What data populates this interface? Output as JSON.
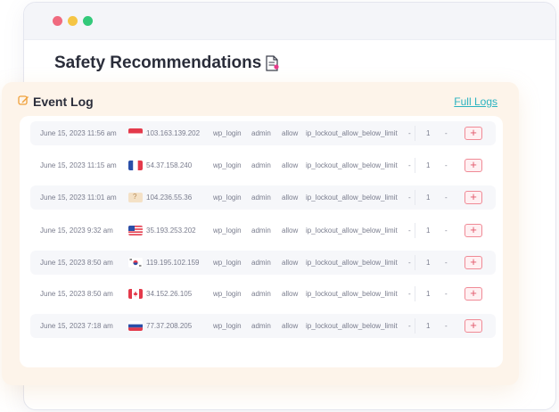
{
  "window": {
    "title": "Safety Recommendations"
  },
  "event_log": {
    "title": "Event Log",
    "full_logs_label": "Full Logs",
    "rows": [
      {
        "date": "June 15, 2023 11:56 am",
        "flag": "indonesia-flag",
        "ip": "103.163.139.202",
        "user": "wp_login",
        "role": "admin",
        "action": "allow",
        "reason": "ip_lockout_allow_below_limit",
        "d1": "-",
        "count": "1",
        "d2": "-",
        "btn": "+"
      },
      {
        "date": "June 15, 2023 11:15 am",
        "flag": "france-flag",
        "ip": "54.37.158.240",
        "user": "wp_login",
        "role": "admin",
        "action": "allow",
        "reason": "ip_lockout_allow_below_limit",
        "d1": "-",
        "count": "1",
        "d2": "-",
        "btn": "+"
      },
      {
        "date": "June 15, 2023 11:01 am",
        "flag": "unknown-flag",
        "flag_text": "?",
        "ip": "104.236.55.36",
        "user": "wp_login",
        "role": "admin",
        "action": "allow",
        "reason": "ip_lockout_allow_below_limit",
        "d1": "-",
        "count": "1",
        "d2": "-",
        "btn": "+"
      },
      {
        "date": "June 15, 2023 9:32 am",
        "flag": "usa-flag",
        "ip": "35.193.253.202",
        "user": "wp_login",
        "role": "admin",
        "action": "allow",
        "reason": "ip_lockout_allow_below_limit",
        "d1": "-",
        "count": "1",
        "d2": "-",
        "btn": "+"
      },
      {
        "date": "June 15, 2023 8:50 am",
        "flag": "south-korea-flag",
        "ip": "119.195.102.159",
        "user": "wp_login",
        "role": "admin",
        "action": "allow",
        "reason": "ip_lockout_allow_below_limit",
        "d1": "-",
        "count": "1",
        "d2": "-",
        "btn": "+"
      },
      {
        "date": "June 15, 2023 8:50 am",
        "flag": "canada-flag",
        "ip": "34.152.26.105",
        "user": "wp_login",
        "role": "admin",
        "action": "allow",
        "reason": "ip_lockout_allow_below_limit",
        "d1": "-",
        "count": "1",
        "d2": "-",
        "btn": "+"
      },
      {
        "date": "June 15, 2023 7:18 am",
        "flag": "russia-flag",
        "ip": "77.37.208.205",
        "user": "wp_login",
        "role": "admin",
        "action": "allow",
        "reason": "ip_lockout_allow_below_limit",
        "d1": "-",
        "count": "1",
        "d2": "-",
        "btn": "+"
      }
    ]
  },
  "colors": {
    "accent_link": "#2bb3c0",
    "card_bg": "#fdf4ea",
    "add_button": "#f08a96"
  }
}
